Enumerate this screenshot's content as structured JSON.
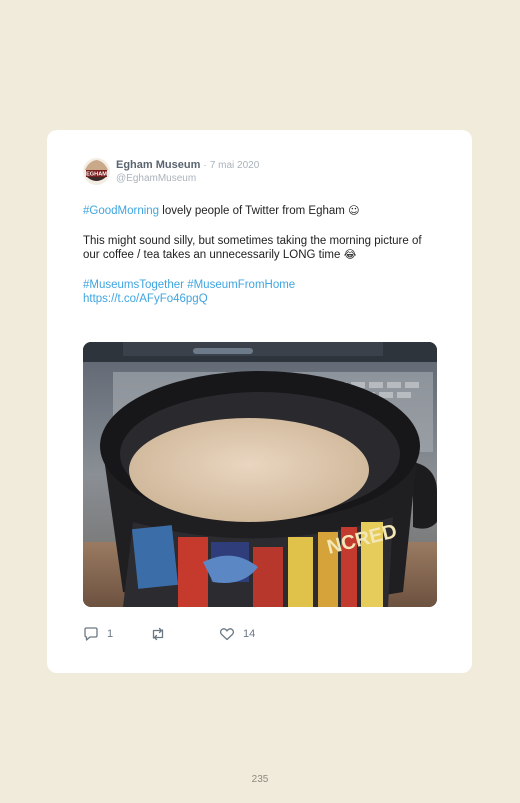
{
  "tweet": {
    "author_name": "Egham Museum",
    "separator": "·",
    "date": "7 mai 2020",
    "handle": "@EghamMuseum",
    "avatar_text": "EGHAM",
    "line1_hashtag": "#GoodMorning",
    "line1_text": " lovely people of Twitter from Egham ",
    "line1_emoji": "☺",
    "paragraph2": "This might sound silly, but sometimes taking the morning picture of our coffee / tea takes an unnecessarily LONG time ",
    "paragraph2_emoji": "😂",
    "hashtag2": "#MuseumsTogether",
    "hashtag3": "#MuseumFromHome",
    "url": "https://t.co/AFyFo46pgQ",
    "photo_alt": "coffee mug"
  },
  "actions": {
    "reply_count": "1",
    "like_count": "14",
    "reply_icon": "reply-icon",
    "retweet_icon": "retweet-icon",
    "like_icon": "heart-icon"
  },
  "page": {
    "number": "235"
  },
  "colors": {
    "background": "#f1ebdc",
    "card": "#ffffff",
    "link": "#3fa5e0",
    "muted": "#aab3bb"
  }
}
